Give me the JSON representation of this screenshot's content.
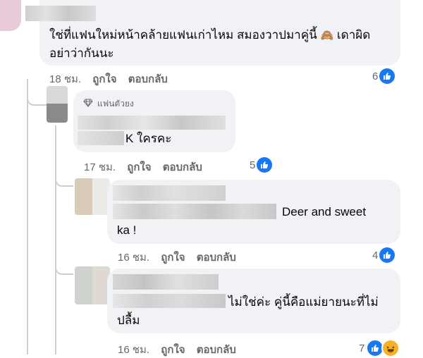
{
  "comments": [
    {
      "text_line1": "ใช่ที่แฟนใหม่หน้าคล้ายแฟนเก่าไหม สมองวาปมาคู่นี้",
      "text_line1_tail": "เดาผิด",
      "text_line2": "อย่าว่ากันนะ",
      "emoji": "🙈",
      "time": "18 ชม.",
      "like_label": "ถูกใจ",
      "reply_label": "ตอบกลับ",
      "reaction_count": "6"
    },
    {
      "badge": "แฟนตัวยง",
      "text_tail": "K ใครคะ",
      "time": "17 ชม.",
      "like_label": "ถูกใจ",
      "reply_label": "ตอบกลับ",
      "reaction_count": "5"
    },
    {
      "text_line1_tail": "Deer and sweet",
      "text_line2": "ka !",
      "time": "16 ชม.",
      "like_label": "ถูกใจ",
      "reply_label": "ตอบกลับ",
      "reaction_count": "4"
    },
    {
      "text_line1_tail": "ไม่ใช่ค่ะ คู่นี้คือแม่ยายนะที่ไม่",
      "text_line2": "ปลื้ม",
      "time": "16 ชม.",
      "like_label": "ถูกใจ",
      "reply_label": "ตอบกลับ",
      "reaction_count": "7"
    }
  ],
  "colors": {
    "like_blue": "#1877f2",
    "bubble_bg": "#f0f2f5",
    "meta_gray": "#65676b"
  },
  "icons": [
    "thumbs-up-icon",
    "haha-icon",
    "diamond-icon",
    "monkey-emoji"
  ]
}
